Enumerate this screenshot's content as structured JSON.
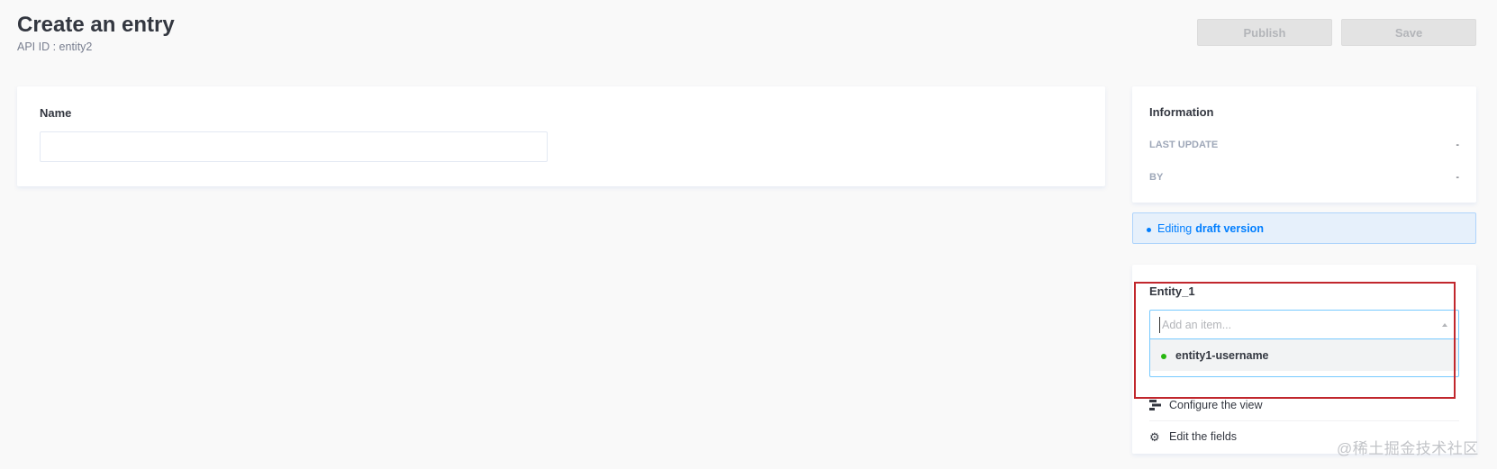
{
  "header": {
    "title": "Create an entry",
    "api_id": "API ID : entity2",
    "publish_label": "Publish",
    "save_label": "Save"
  },
  "form": {
    "name_label": "Name",
    "name_value": ""
  },
  "information": {
    "title": "Information",
    "rows": [
      {
        "label": "LAST UPDATE",
        "value": "-"
      },
      {
        "label": "BY",
        "value": "-"
      }
    ]
  },
  "draft": {
    "prefix": "Editing",
    "strong": "draft version",
    "color": "#007eff"
  },
  "relation": {
    "label": "Entity_1",
    "placeholder": "Add an item...",
    "options": [
      {
        "label": "entity1-username",
        "status_color": "#27b70f"
      }
    ]
  },
  "links": {
    "configure_view": "Configure the view",
    "edit_fields": "Edit the fields"
  },
  "watermark": "@稀土掘金技术社区",
  "colors": {
    "highlight": "#c1272d",
    "focus_border": "#78caff"
  }
}
